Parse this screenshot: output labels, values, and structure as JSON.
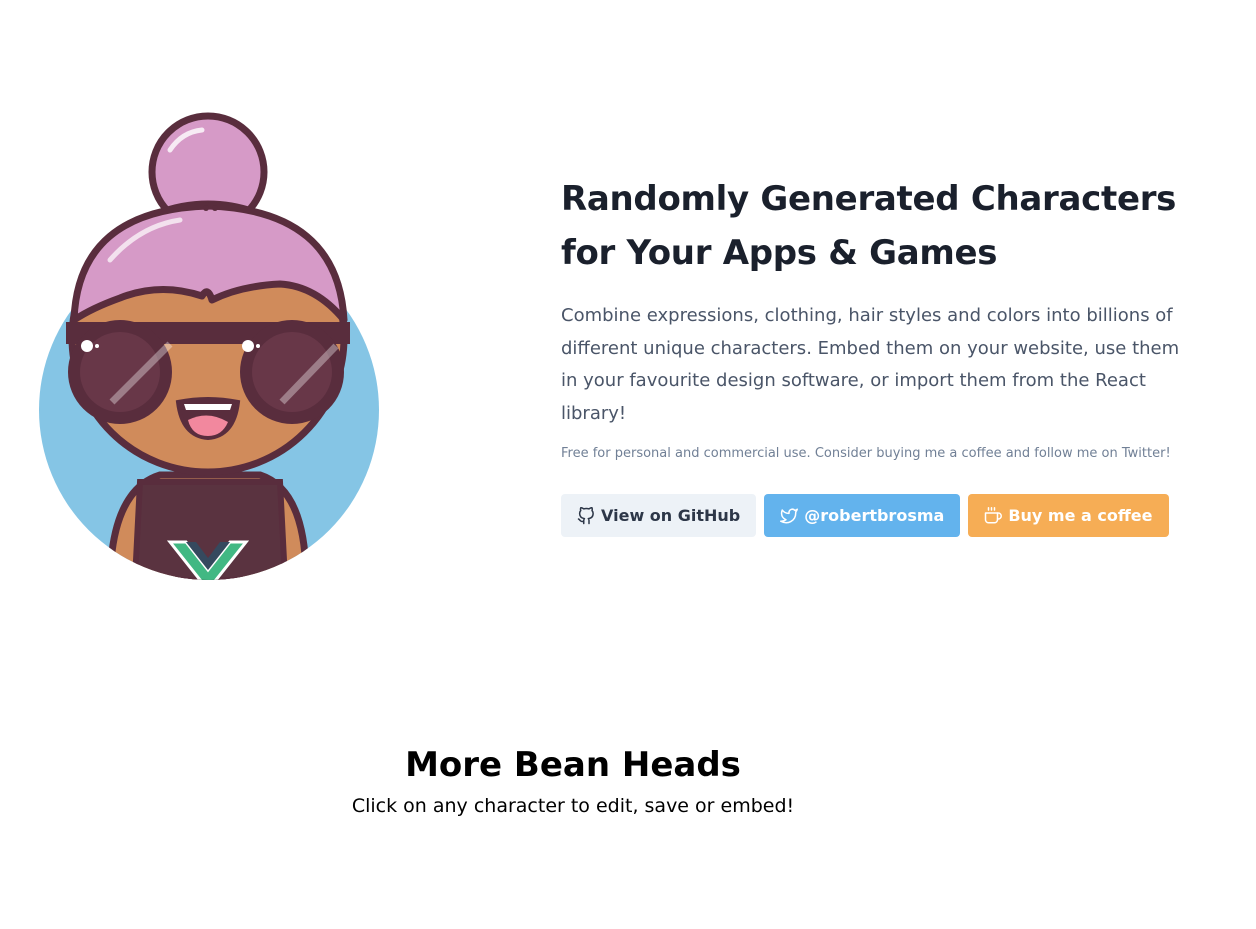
{
  "hero": {
    "title": "Randomly Generated Characters for Your Apps & Games",
    "description": "Combine expressions, clothing, hair styles and colors into billions of different unique characters. Embed them on your website, use them in your favourite design software, or import them from the React library!",
    "note": "Free for personal and commercial use. Consider buying me a coffee and follow me on Twitter!",
    "avatar": {
      "icon": "bean-head-avatar",
      "colors": {
        "background": "#85c5e5",
        "hair": "#d69ac7",
        "skin": "#d08b5b",
        "outline": "#592d3d",
        "glasses": "#592d3d",
        "shirt": "#5a3340",
        "logo_green": "#41b883",
        "logo_dark": "#35495e",
        "mouth": "#f2889e"
      }
    }
  },
  "buttons": {
    "github": {
      "label": "View on GitHub",
      "icon": "github-icon"
    },
    "twitter": {
      "label": "@robertbrosma",
      "icon": "twitter-icon"
    },
    "coffee": {
      "label": "Buy me a coffee",
      "icon": "coffee-icon"
    }
  },
  "more": {
    "title": "More Bean Heads",
    "subtitle": "Click on any character to edit, save or embed!"
  },
  "colors": {
    "github_bg": "#edf2f7",
    "twitter_bg": "#63b3ed",
    "coffee_bg": "#f6ad55",
    "title_text": "#1a202c",
    "body_text": "#4a5568"
  }
}
